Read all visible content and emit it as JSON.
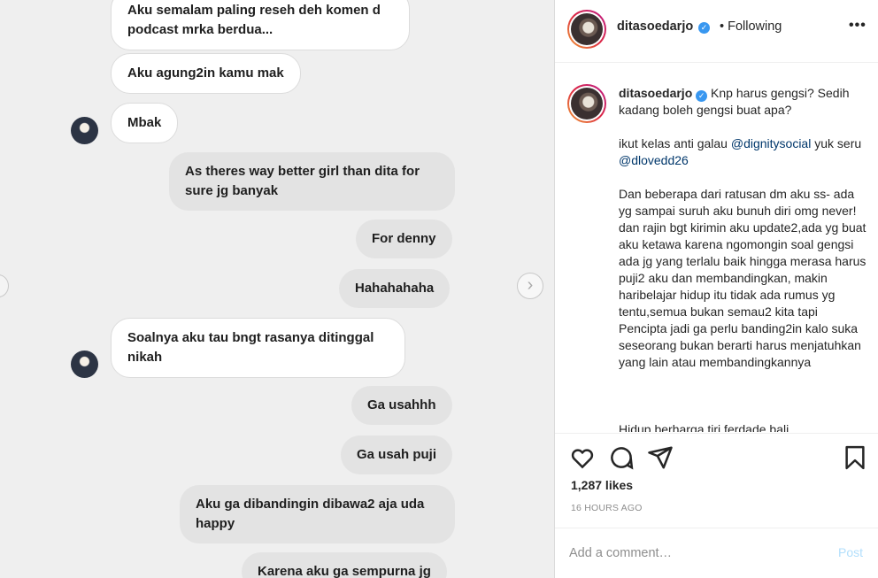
{
  "chat": {
    "messages": [
      {
        "side": "in",
        "text": "Aku semalam paling reseh deh komen d podcast mrka berdua..."
      },
      {
        "side": "in",
        "text": "Aku agung2in kamu mak"
      },
      {
        "side": "in",
        "text": "Mbak"
      },
      {
        "side": "out",
        "text": "As theres way better girl than dita for sure jg banyak"
      },
      {
        "side": "out",
        "text": "For denny"
      },
      {
        "side": "out",
        "text": "Hahahahaha"
      },
      {
        "side": "in",
        "text": "Soalnya aku tau bngt rasanya ditinggal nikah"
      },
      {
        "side": "out",
        "text": "Ga usahhh"
      },
      {
        "side": "out",
        "text": "Ga usah puji"
      },
      {
        "side": "out",
        "text": "Aku ga dibandingin dibawa2 aja uda happy"
      },
      {
        "side": "out",
        "text": "Karena aku ga sempurna jg"
      }
    ],
    "next_icon": "chevron-right-icon",
    "prev_icon": "chevron-left-icon"
  },
  "header": {
    "username": "ditasoedarjo",
    "separator": "•",
    "following": "Following",
    "more": "•••"
  },
  "caption": {
    "username": "ditasoedarjo",
    "p1": "Knp harus gengsi? Sedih kadang boleh gengsi buat apa?",
    "p2_pre": "ikut kelas anti galau ",
    "mention1": "@dignitysocial",
    "p2_mid": " yuk seru ",
    "mention2": "@dlovedd26",
    "p3": "Dan beberapa dari ratusan dm aku ss- ada yg sampai suruh aku bunuh diri omg never! dan rajin bgt kirimin aku update2,ada yg buat aku ketawa karena ngomongin soal gengsi ada jg yang terlalu baik hingga merasa harus puji2 aku dan membandingkan, makin haribelajar hidup itu tidak ada rumus yg tentu,semua bukan semau2 kita tapi Pencipta jadi ga perlu banding2in kalo suka seseorang bukan berarti harus menjatuhkan yang lain atau membandingkannya",
    "p4": "Hidup berharga tiri ferdade bali"
  },
  "actions": {
    "like_icon": "heart-icon",
    "comment_icon": "comment-icon",
    "share_icon": "share-icon",
    "save_icon": "bookmark-icon"
  },
  "likes": "1,287 likes",
  "timestamp": "16 HOURS AGO",
  "comment": {
    "placeholder": "Add a comment…",
    "post_label": "Post"
  },
  "colors": {
    "link": "#00376b",
    "verified": "#3897f0",
    "post_disabled": "#b2dffc"
  }
}
